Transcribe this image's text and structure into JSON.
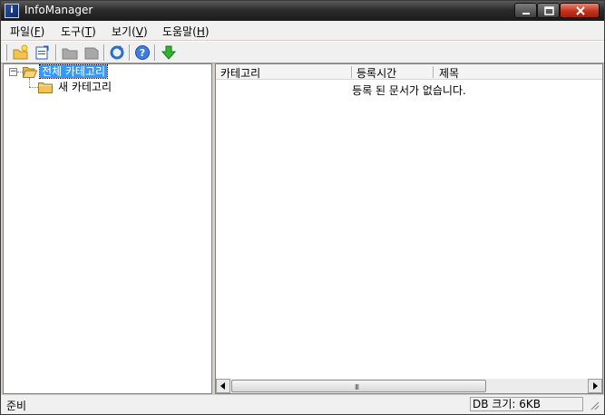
{
  "window": {
    "title": "InfoManager",
    "app_icon": "app-icon"
  },
  "menu": {
    "items": [
      {
        "label": "파일(",
        "key": "F",
        "suffix": ")"
      },
      {
        "label": "도구(",
        "key": "T",
        "suffix": ")"
      },
      {
        "label": "보기(",
        "key": "V",
        "suffix": ")"
      },
      {
        "label": "도움말(",
        "key": "H",
        "suffix": ")"
      }
    ]
  },
  "toolbar": {
    "buttons": [
      {
        "name": "new-category-icon"
      },
      {
        "name": "edit-category-icon"
      },
      {
        "name": "disabled-folder-icon"
      },
      {
        "name": "disabled-delete-icon"
      },
      {
        "name": "refresh-icon"
      },
      {
        "name": "help-icon"
      },
      {
        "name": "download-arrow-icon"
      }
    ]
  },
  "tree": {
    "root_label": "전체 카테고리",
    "root_toggle": "−",
    "child_label": "새 카테고리"
  },
  "list": {
    "columns": [
      "카테고리",
      "등록시간",
      "제목"
    ],
    "empty_message": "등록 된 문서가 없습니다.",
    "scroll_grip": "III"
  },
  "status": {
    "left": "준비",
    "db_size": "DB 크기: 6KB"
  }
}
